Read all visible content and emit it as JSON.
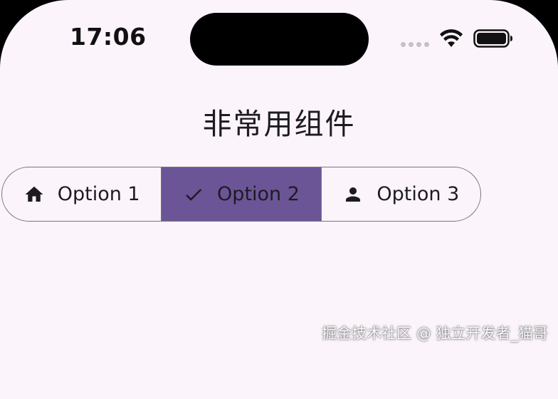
{
  "status_bar": {
    "time": "17:06",
    "icons": [
      "signal-dots-icon",
      "wifi-icon",
      "battery-icon"
    ]
  },
  "page": {
    "title": "非常用组件"
  },
  "segmented_button": {
    "segments": [
      {
        "label": "Option 1",
        "icon": "home-icon",
        "selected": false
      },
      {
        "label": "Option 2",
        "icon": "check-icon",
        "selected": true
      },
      {
        "label": "Option 3",
        "icon": "person-icon",
        "selected": false
      }
    ]
  },
  "colors": {
    "background": "#fbf4fb",
    "selected_segment": "#6b5597",
    "outline": "#79747e",
    "text": "#1d1b20"
  },
  "watermark": "掘金技术社区 @ 独立开发者_猫哥"
}
